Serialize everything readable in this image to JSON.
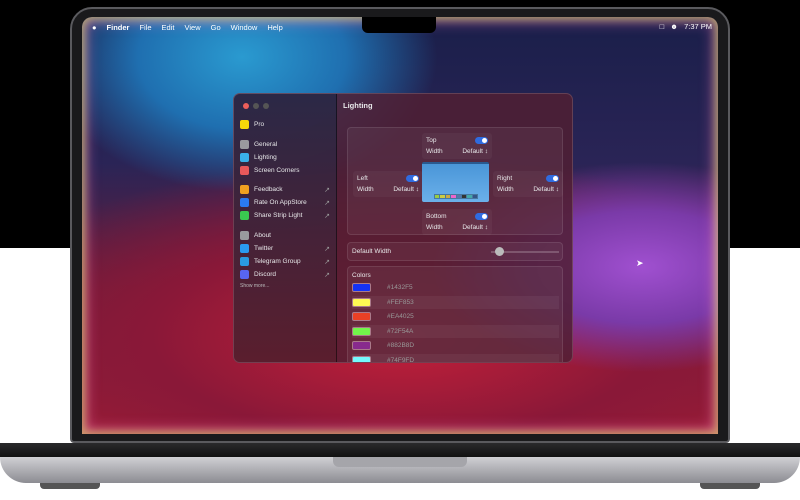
{
  "menubar": {
    "app": "Finder",
    "items": [
      "File",
      "Edit",
      "View",
      "Go",
      "Window",
      "Help"
    ],
    "time": "7:37 PM"
  },
  "window": {
    "title": "Lighting",
    "sidebar": [
      {
        "label": "Pro",
        "color": "#f5d90a"
      },
      {
        "label": "General",
        "color": "#9a9a9e"
      },
      {
        "label": "Lighting",
        "color": "#3ab0e8"
      },
      {
        "label": "Screen Corners",
        "color": "#e8585a"
      },
      {
        "label": "Feedback",
        "color": "#f0a020",
        "ext": true
      },
      {
        "label": "Rate On AppStore",
        "color": "#2a7af0",
        "ext": true
      },
      {
        "label": "Share Strip Light",
        "color": "#3ac850",
        "ext": true
      },
      {
        "label": "About",
        "color": "#9a9a9e"
      },
      {
        "label": "Twitter",
        "color": "#2a9af0",
        "ext": true
      },
      {
        "label": "Telegram Group",
        "color": "#2a9ae0",
        "ext": true
      },
      {
        "label": "Discord",
        "color": "#5865f2",
        "ext": true
      }
    ],
    "show_more": "Show more...",
    "edges": {
      "top": "Top",
      "left": "Left",
      "right": "Right",
      "bottom": "Bottom",
      "width_label": "Width",
      "width_value": "Default"
    },
    "default_width": {
      "label": "Default Width",
      "value": 0.12
    },
    "colors_label": "Colors",
    "colors": [
      {
        "hex": "#1432F5"
      },
      {
        "hex": "#FEF853"
      },
      {
        "hex": "#EA4025"
      },
      {
        "hex": "#72F54A"
      },
      {
        "hex": "#882B8D"
      },
      {
        "hex": "#74F9FD"
      }
    ]
  }
}
